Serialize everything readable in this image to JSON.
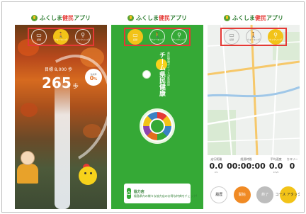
{
  "app": {
    "title_prefix": "ふくしま",
    "title_highlight": "健民",
    "title_suffix": "アプリ"
  },
  "modes": [
    {
      "label": "記録",
      "icon": "card-icon"
    },
    {
      "label": "ウォーキング",
      "icon": "walk-icon"
    },
    {
      "label": "サイクリング",
      "icon": "bicycle-icon"
    }
  ],
  "walking_screen": {
    "goal_text": "目標 8,000 歩",
    "steps_value": "265",
    "steps_unit": "歩",
    "percent_value": "0",
    "percent_unit": "%",
    "percent_caption": "達成率"
  },
  "card_screen": {
    "vertical_title": "チーム県民健康",
    "vertical_subtitle": "県民健康ポイント対象施設",
    "coupon_title": "協力店",
    "coupon_text": "福島県内の様々な協力店のお得な特典をチェック!"
  },
  "cycling_screen": {
    "stats": [
      {
        "label": "走行距離",
        "value": "0.0",
        "unit": "km"
      },
      {
        "label": "経過時間",
        "value": "00:00:00",
        "unit": ""
      },
      {
        "label": "平均速度",
        "value": "0.0",
        "unit": "km/h"
      },
      {
        "label": "カロリー",
        "value": "0",
        "unit": ""
      }
    ],
    "actions": [
      {
        "label": "履歴"
      },
      {
        "label": "開始"
      },
      {
        "label": "終了"
      },
      {
        "label": "コース アタック"
      }
    ]
  },
  "colors": {
    "brand_green": "#35a936",
    "accent_yellow": "#f2c318",
    "accent_orange": "#f08a24",
    "highlight_red": "#e53935"
  }
}
